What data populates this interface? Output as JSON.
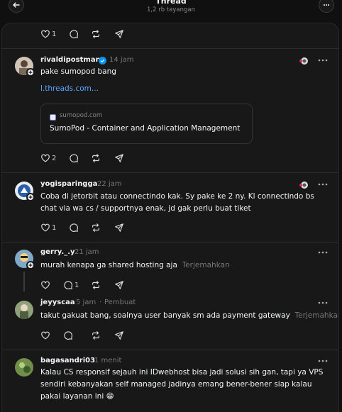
{
  "header": {
    "title": "Thread",
    "subtitle": "1,2 rb tayangan"
  },
  "top_actions": {
    "likes": "1"
  },
  "posts": [
    {
      "username": "rivaldipostman",
      "time": "14 jam",
      "text": "pake sumopod bang",
      "link": "l.threads.com...",
      "card": {
        "domain": "sumopod.com",
        "title": "SumoPod - Container and Application Management"
      },
      "likes": "2"
    },
    {
      "username": "yogisparingga",
      "time": "22 jam",
      "text": "Coba di jetorbit atau connectindo kak. Sy pake ke 2 ny. Kl connectindo bs chat via wa cs / supportnya enak, jd gak perlu buat tiket",
      "likes": "1"
    },
    {
      "username": "gerry._.y",
      "time": "21 jam",
      "text": "murah kenapa ga shared hosting aja",
      "translate": "Terjemahkan",
      "replies": "1"
    },
    {
      "username": "jeyyscaa",
      "time": "5 jam",
      "author_tag": "Pembuat",
      "text": "takut gakuat bang, soalnya user banyak sm ada payment gateway",
      "translate": "Terjemahkan"
    },
    {
      "username": "bagasandri03",
      "time": "1 menit",
      "text": "Kalau CS responsif sejauh ini IDwebhost bisa jadi solusi sih gan, tapi ya VPS sendiri kebanyakan self managed jadinya emang bener-bener siap kalau pakai layanan ini 😁"
    }
  ],
  "colors": {
    "background": "#101010",
    "panel": "#181818",
    "link": "#5aa7ff",
    "verified": "#0095f6",
    "muted": "#777777"
  },
  "icons": [
    "back-arrow-icon",
    "more-circle-icon",
    "heart-icon",
    "comment-icon",
    "repost-icon",
    "share-icon",
    "verified-icon",
    "more-dots-icon"
  ]
}
